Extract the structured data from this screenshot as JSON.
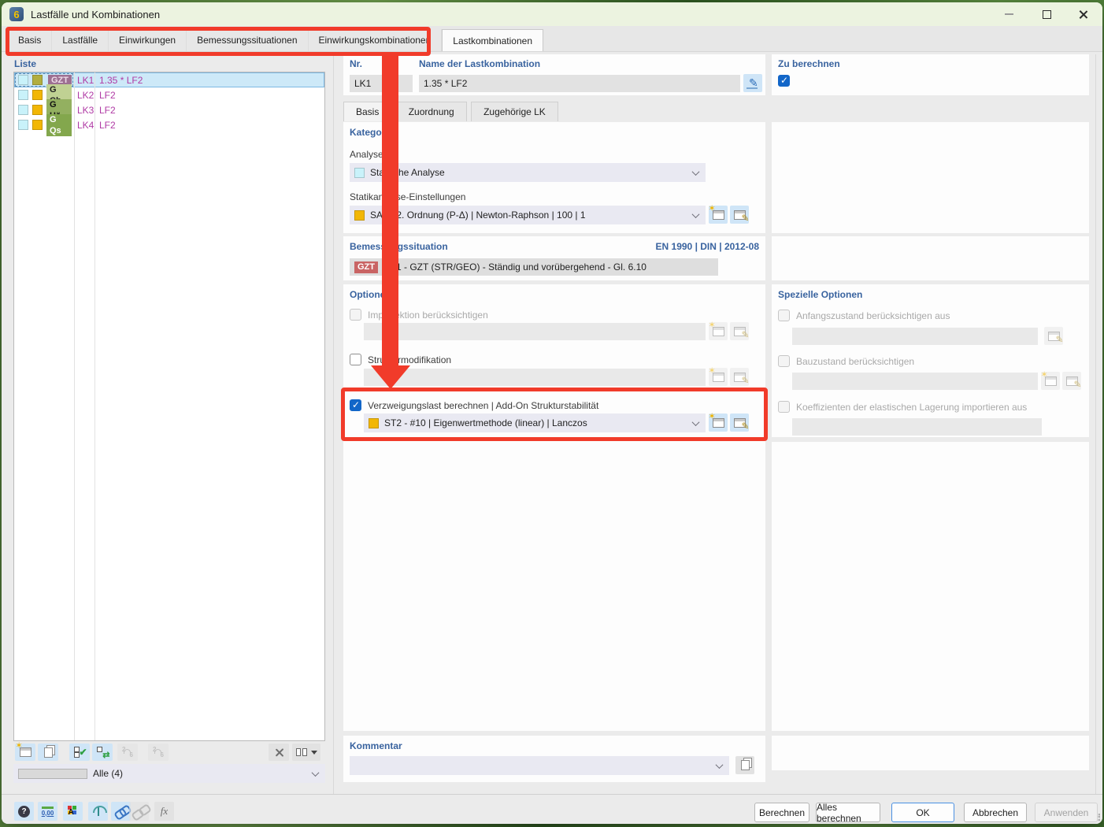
{
  "window": {
    "title": "Lastfälle und Kombinationen"
  },
  "main_tabs": [
    {
      "label": "Basis",
      "active": false
    },
    {
      "label": "Lastfälle",
      "active": false
    },
    {
      "label": "Einwirkungen",
      "active": false
    },
    {
      "label": "Bemessungssituationen",
      "active": false
    },
    {
      "label": "Einwirkungskombinationen",
      "active": false
    },
    {
      "label": "Lastkombinationen",
      "active": true
    }
  ],
  "list_panel": {
    "header": "Liste",
    "rows": [
      {
        "badge": "GZT",
        "lk": "LK1",
        "name": "1.35 * LF2",
        "selected": true
      },
      {
        "badge": "G Ch",
        "lk": "LK2",
        "name": "LF2",
        "selected": false
      },
      {
        "badge": "G Hä",
        "lk": "LK3",
        "name": "LF2",
        "selected": false
      },
      {
        "badge": "G Qs",
        "lk": "LK4",
        "name": "LF2",
        "selected": false
      }
    ],
    "filter_label": "Alle (4)"
  },
  "detail": {
    "nr": {
      "label": "Nr.",
      "value": "LK1"
    },
    "name": {
      "label": "Name der Lastkombination",
      "value": "1.35 * LF2"
    },
    "to_calculate": {
      "label": "Zu berechnen",
      "checked": true
    },
    "sub_tabs": [
      {
        "label": "Basis",
        "active": true
      },
      {
        "label": "Zuordnung",
        "active": false
      },
      {
        "label": "Zugehörige LK",
        "active": false
      }
    ],
    "kategorie": {
      "header": "Kategorie",
      "analysetyp_label": "Analysetyp",
      "analysetyp_value": "Statische Analyse",
      "sa_label": "Statikanalyse-Einstellungen",
      "sa_value": "SA2 - 2. Ordnung (P-Δ) | Newton-Raphson | 100 | 1"
    },
    "bemessung": {
      "header": "Bemessungssituation",
      "norm": "EN 1990 | DIN | 2012-08",
      "badge": "GZT",
      "value": "BS1 - GZT (STR/GEO) - Ständig und vorübergehend - Gl. 6.10"
    },
    "optionen": {
      "header": "Optionen",
      "imperfektion": {
        "label": "Imperfektion berücksichtigen",
        "checked": false,
        "disabled": true
      },
      "struktur": {
        "label": "Strukturmodifikation",
        "checked": false,
        "disabled": false
      },
      "verzweigung": {
        "label": "Verzweigungslast berechnen | Add-On Strukturstabilität",
        "checked": true,
        "value": "ST2 - #10 | Eigenwertmethode (linear) | Lanczos"
      }
    },
    "kommentar": {
      "header": "Kommentar",
      "value": ""
    },
    "spezielle": {
      "header": "Spezielle Optionen",
      "items": [
        {
          "label": "Anfangszustand berücksichtigen aus",
          "checked": false
        },
        {
          "label": "Bauzustand berücksichtigen",
          "checked": false
        },
        {
          "label": "Koeffizienten der elastischen Lagerung importieren aus",
          "checked": false
        }
      ]
    }
  },
  "toolbar": {
    "units_label": "0,00",
    "fx_label": "fx"
  },
  "footer": {
    "buttons": [
      {
        "label": "Berechnen",
        "state": "normal"
      },
      {
        "label": "Alles berechnen",
        "state": "normal"
      },
      {
        "label": "OK",
        "state": "focused"
      },
      {
        "label": "Abbrechen",
        "state": "normal"
      },
      {
        "label": "Anwenden",
        "state": "disabled"
      }
    ]
  },
  "colors": {
    "annotation_red": "#f13b2a",
    "label_blue": "#39639f",
    "list_text_magenta": "#b03aa5",
    "checkbox_blue": "#1266c8",
    "selection_blue": "#cde9f8",
    "badge_gzt_list": "#9d7092",
    "badge_gzt_field": "#c96464",
    "badge_g_ch": "#c0d193",
    "badge_g_ha": "#93b060",
    "badge_g_qs": "#83a74d",
    "swatch_cyan": "#c9f2fa",
    "swatch_amber": "#f2b705",
    "swatch_olive": "#b2ae3f",
    "titlebar_green": "#ecf3e0"
  }
}
